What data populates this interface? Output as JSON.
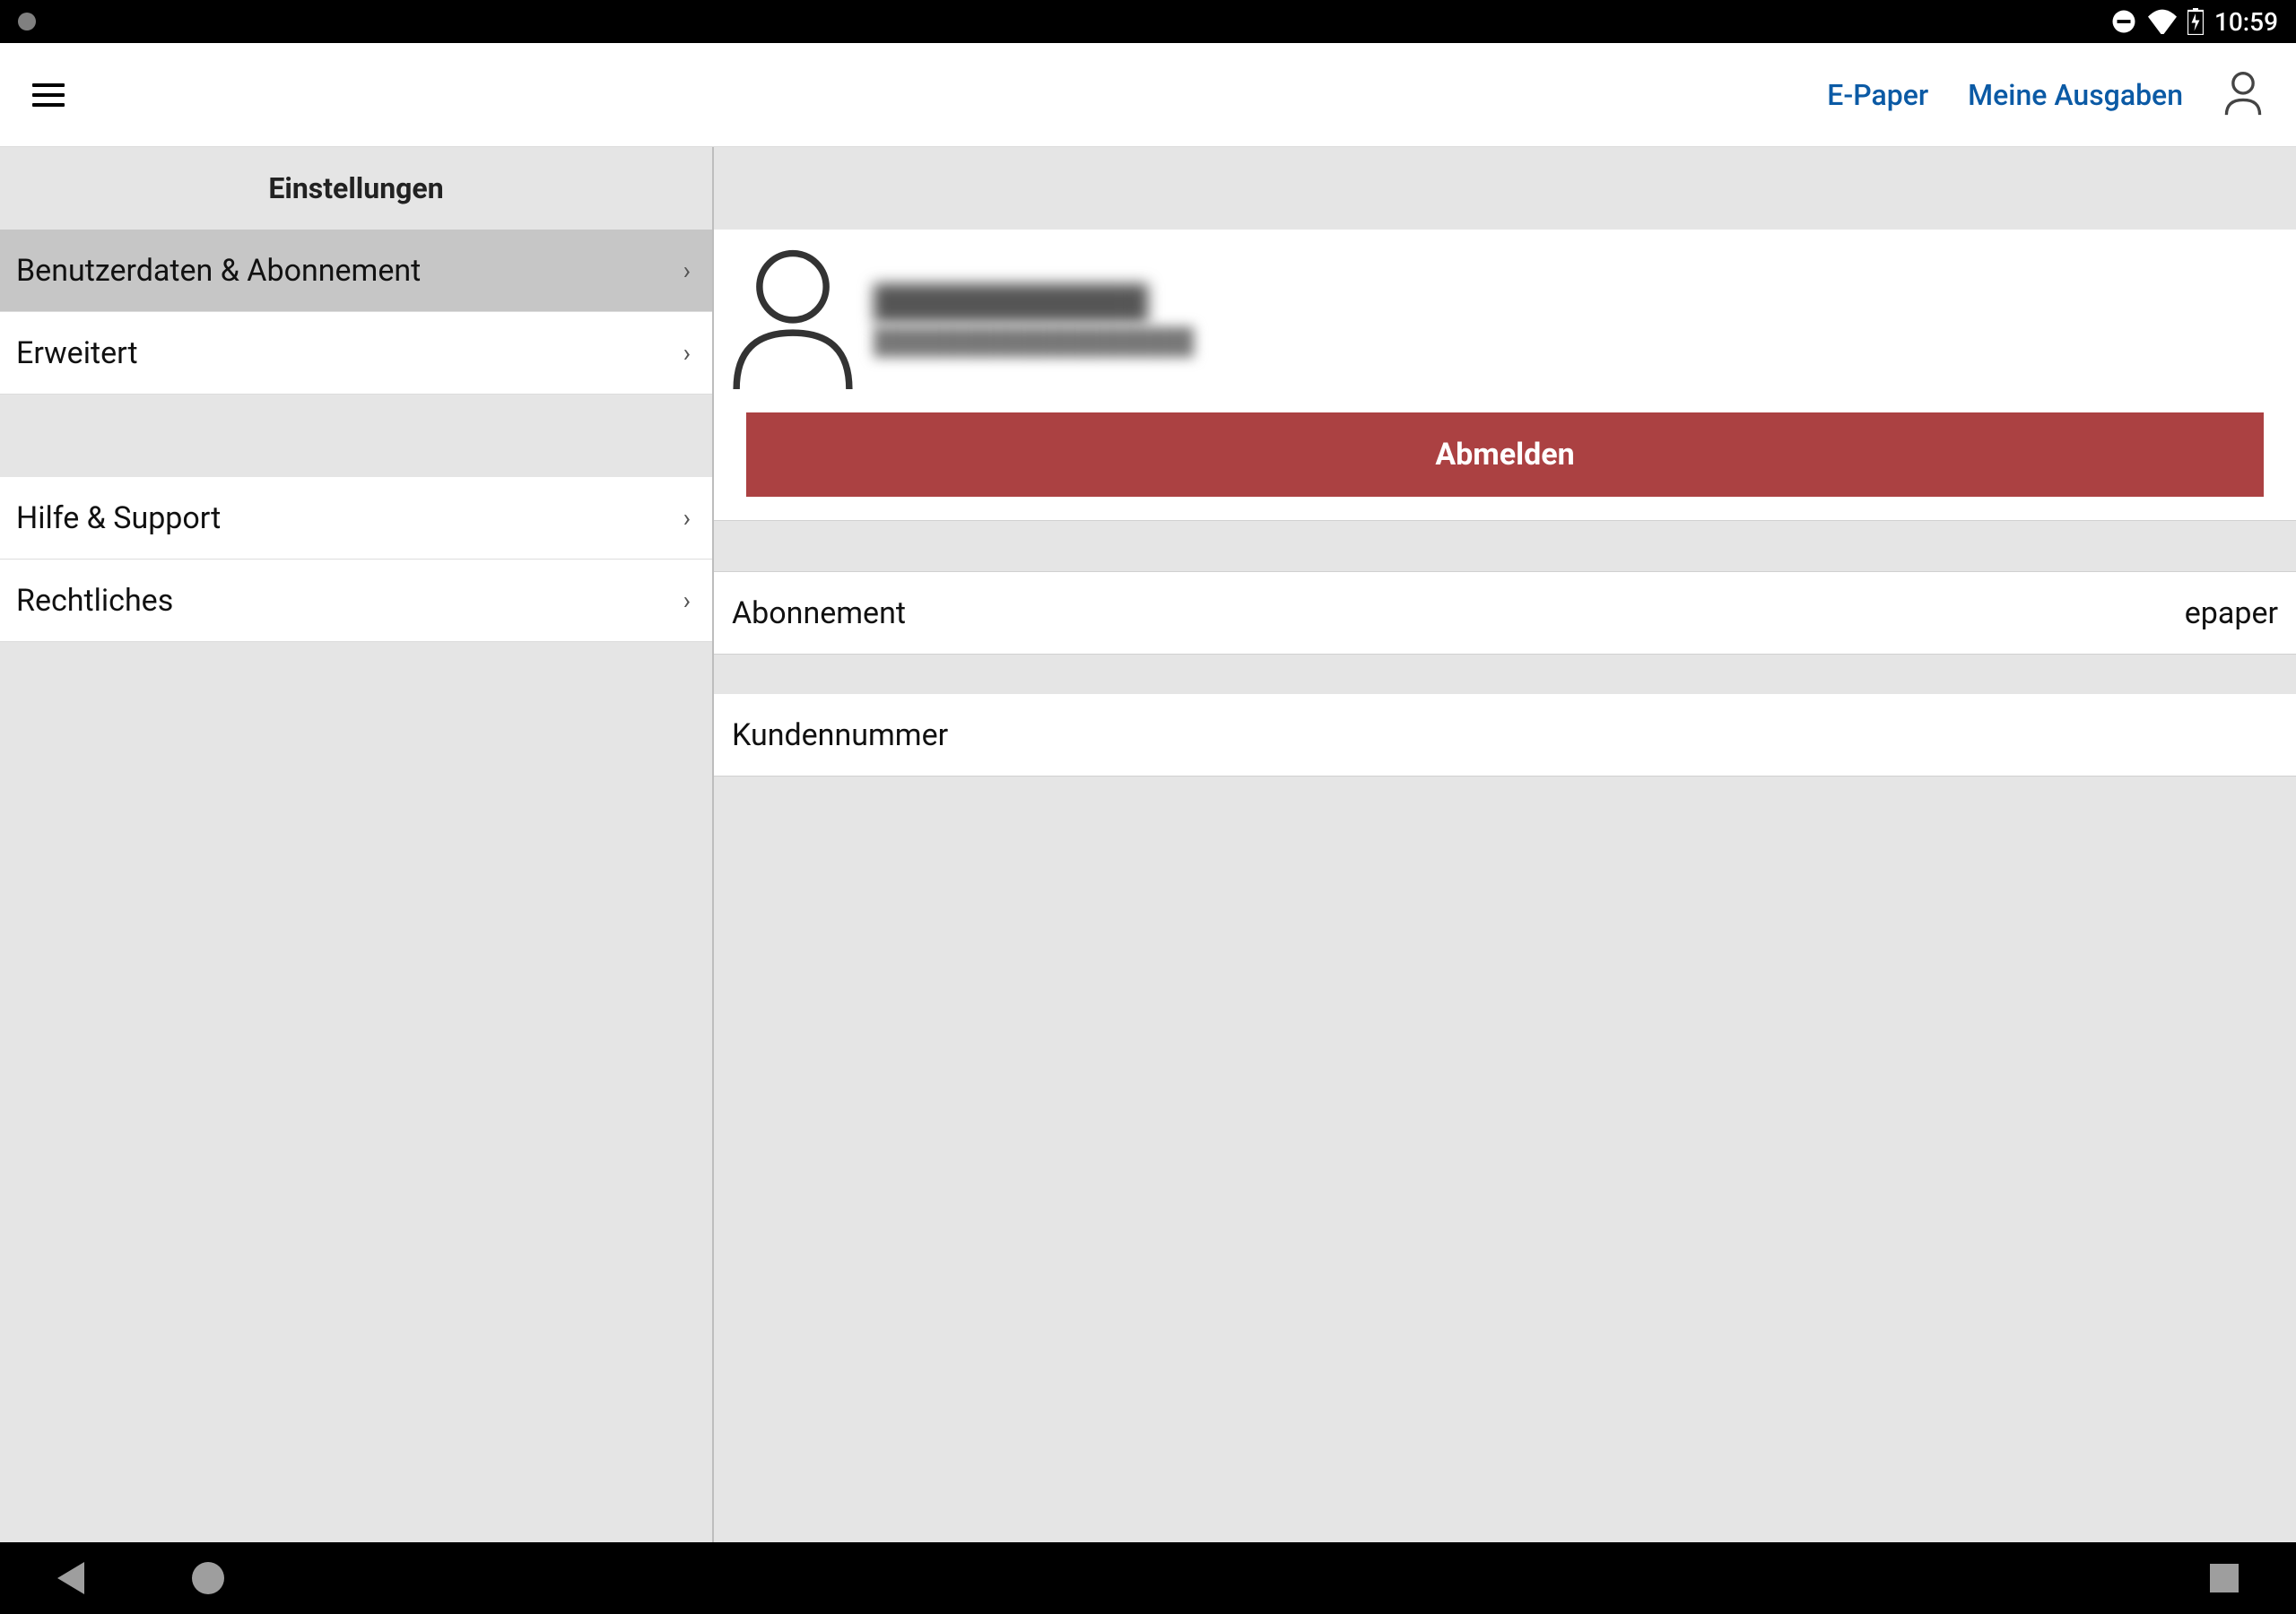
{
  "status": {
    "time": "10:59"
  },
  "toolbar": {
    "links": [
      "E-Paper",
      "Meine Ausgaben"
    ]
  },
  "sidebar": {
    "title": "Einstellungen",
    "group1": [
      {
        "label": "Benutzerdaten & Abonnement",
        "selected": true
      },
      {
        "label": "Erweitert",
        "selected": false
      }
    ],
    "group2": [
      {
        "label": "Hilfe & Support"
      },
      {
        "label": "Rechtliches"
      }
    ]
  },
  "profile": {
    "name_redacted": "████████████",
    "email_redacted": "██████████████████",
    "logout_label": "Abmelden"
  },
  "details": {
    "subscription_label": "Abonnement",
    "subscription_value": "epaper",
    "customer_number_label": "Kundennummer",
    "customer_number_value": ""
  }
}
